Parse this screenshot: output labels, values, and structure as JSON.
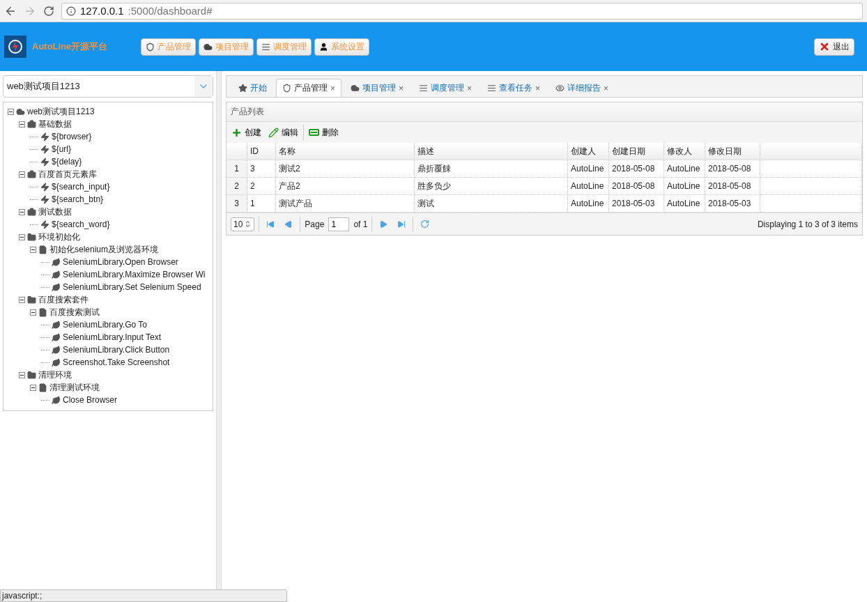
{
  "browser": {
    "url_host": "127.0.0.1",
    "url_rest": ":5000/dashboard#"
  },
  "header": {
    "brand": "AutoLine开源平台",
    "nav": [
      {
        "label": "产品管理",
        "kind": "shield"
      },
      {
        "label": "项目管理",
        "kind": "cloud"
      },
      {
        "label": "调度管理",
        "kind": "list"
      },
      {
        "label": "系统设置",
        "kind": "user"
      }
    ],
    "logout": "退出"
  },
  "sidebar": {
    "project_select": "web测试项目1213",
    "tree": [
      {
        "label": "web测试项目1213",
        "kind": "cloud",
        "expanded": true,
        "children": [
          {
            "label": "基础数据",
            "kind": "briefcase",
            "expanded": true,
            "children": [
              {
                "label": "${browser}",
                "kind": "bolt"
              },
              {
                "label": "${url}",
                "kind": "bolt"
              },
              {
                "label": "${delay}",
                "kind": "bolt"
              }
            ]
          },
          {
            "label": "百度首页元素库",
            "kind": "briefcase",
            "expanded": true,
            "children": [
              {
                "label": "${search_input}",
                "kind": "bolt"
              },
              {
                "label": "${search_btn}",
                "kind": "bolt"
              }
            ]
          },
          {
            "label": "测试数据",
            "kind": "briefcase",
            "expanded": true,
            "children": [
              {
                "label": "${search_word}",
                "kind": "bolt"
              }
            ]
          },
          {
            "label": "环境初始化",
            "kind": "folder",
            "expanded": true,
            "children": [
              {
                "label": "初始化selenium及浏览器环境",
                "kind": "file",
                "expanded": true,
                "children": [
                  {
                    "label": "SeleniumLibrary.Open Browser",
                    "kind": "leaf"
                  },
                  {
                    "label": "SeleniumLibrary.Maximize Browser Wi",
                    "kind": "leaf"
                  },
                  {
                    "label": "SeleniumLibrary.Set Selenium Speed",
                    "kind": "leaf"
                  }
                ]
              }
            ]
          },
          {
            "label": "百度搜索套件",
            "kind": "folder",
            "expanded": true,
            "children": [
              {
                "label": "百度搜索测试",
                "kind": "file",
                "expanded": true,
                "children": [
                  {
                    "label": "SeleniumLibrary.Go To",
                    "kind": "leaf"
                  },
                  {
                    "label": "SeleniumLibrary.Input Text",
                    "kind": "leaf"
                  },
                  {
                    "label": "SeleniumLibrary.Click Button",
                    "kind": "leaf"
                  },
                  {
                    "label": "Screenshot.Take Screenshot",
                    "kind": "leaf"
                  }
                ]
              }
            ]
          },
          {
            "label": "清理环境",
            "kind": "folder",
            "expanded": true,
            "children": [
              {
                "label": "清理测试环境",
                "kind": "file",
                "expanded": true,
                "children": [
                  {
                    "label": "Close Browser",
                    "kind": "leaf"
                  }
                ]
              }
            ]
          }
        ]
      }
    ]
  },
  "tabs": [
    {
      "label": "开始",
      "kind": "star",
      "selected": false,
      "closable": false
    },
    {
      "label": "产品管理",
      "kind": "shield",
      "selected": true,
      "closable": true
    },
    {
      "label": "项目管理",
      "kind": "cloud",
      "selected": false,
      "closable": true
    },
    {
      "label": "调度管理",
      "kind": "list",
      "selected": false,
      "closable": true
    },
    {
      "label": "查看任务",
      "kind": "list",
      "selected": false,
      "closable": true
    },
    {
      "label": "详细报告",
      "kind": "eye",
      "selected": false,
      "closable": true
    }
  ],
  "close_mark": "×",
  "panel": {
    "title": "产品列表",
    "toolbar": [
      {
        "label": "创建",
        "kind": "plus"
      },
      {
        "label": "编辑",
        "kind": "pencil"
      },
      {
        "label": "删除",
        "kind": "minus"
      }
    ],
    "table": {
      "columns": [
        "ID",
        "名称",
        "描述",
        "创建人",
        "创建日期",
        "修改人",
        "修改日期"
      ],
      "rows": [
        {
          "number": "1",
          "cells": [
            "3",
            "测试2",
            "鼎折覆餗",
            "AutoLine",
            "2018-05-08",
            "AutoLine",
            "2018-05-08"
          ]
        },
        {
          "number": "2",
          "cells": [
            "2",
            "产品2",
            "胜多负少",
            "AutoLine",
            "2018-05-08",
            "AutoLine",
            "2018-05-08"
          ]
        },
        {
          "number": "3",
          "cells": [
            "1",
            "测试产品",
            "测试",
            "AutoLine",
            "2018-05-03",
            "AutoLine",
            "2018-05-03"
          ]
        }
      ]
    },
    "pager": {
      "page_size": "10",
      "page_label": "Page",
      "page": "1",
      "of": "of 1",
      "info": "Displaying 1 to 3 of 3 items"
    }
  },
  "status_tooltip": "javascript:;"
}
